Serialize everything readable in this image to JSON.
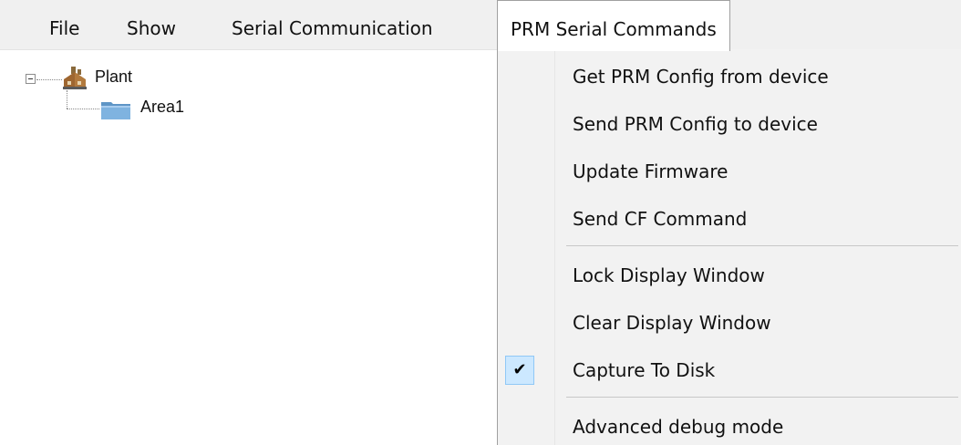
{
  "menubar": {
    "items": [
      {
        "label": "File"
      },
      {
        "label": "Show"
      },
      {
        "label": "Serial Communication"
      },
      {
        "label": "PRM Serial Commands"
      }
    ]
  },
  "tree": {
    "root": {
      "label": "Plant",
      "icon": "factory-icon",
      "expanded": true
    },
    "children": [
      {
        "label": "Area1",
        "icon": "folder-icon"
      }
    ]
  },
  "dropdown": {
    "items": [
      {
        "label": "Get PRM Config from device"
      },
      {
        "label": "Send PRM Config to device"
      },
      {
        "label": "Update Firmware"
      },
      {
        "label": "Send CF Command"
      },
      {
        "label": "Lock Display Window"
      },
      {
        "label": "Clear Display Window"
      },
      {
        "label": "Capture To Disk",
        "checked": true,
        "check_glyph": "✔"
      },
      {
        "label": "Advanced debug mode"
      }
    ]
  },
  "colors": {
    "menubar_bg": "#f0f0f0",
    "dropdown_bg": "#f2f2f2",
    "check_highlight": "#cce8ff",
    "folder": "#6fa8d6"
  }
}
